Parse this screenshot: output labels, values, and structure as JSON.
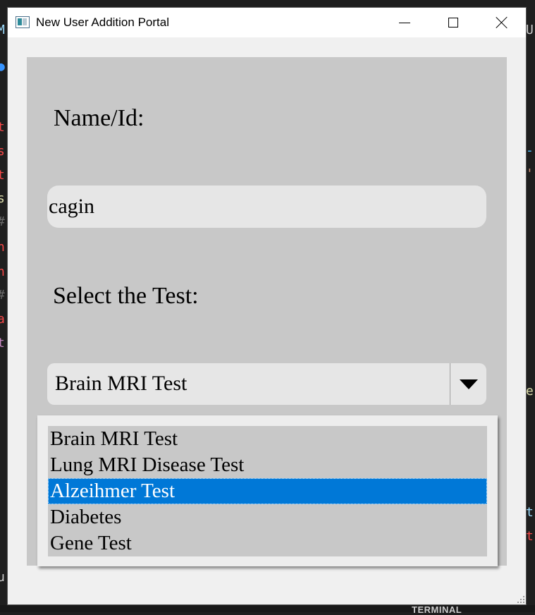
{
  "window": {
    "title": "New User Addition Portal",
    "minimize_icon": "minimize-icon",
    "maximize_icon": "maximize-icon",
    "close_icon": "close-icon"
  },
  "form": {
    "name_label": "Name/Id:",
    "name_value": "cagin",
    "test_label": "Select the Test:",
    "test_selected": "Brain MRI Test",
    "dropdown_icon": "triangle-down-icon"
  },
  "dropdown": {
    "options": [
      "Brain MRI Test",
      "Lung MRI Disease Test",
      "Alzeihmer Test",
      "Diabetes",
      "Gene Test"
    ],
    "highlighted_index": 2
  },
  "background": {
    "terminal_tab": "TERMINAL"
  },
  "colors": {
    "panel_bg": "#c8c8c8",
    "input_bg": "#e6e6e6",
    "highlight": "#0078d7",
    "window_bg": "#f0f0f0"
  }
}
